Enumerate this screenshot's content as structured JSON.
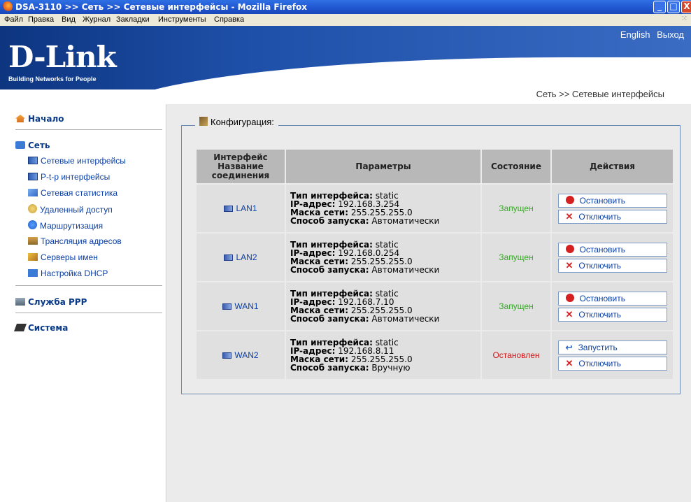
{
  "window": {
    "title": "DSA-3110 >> Сеть >> Сетевые интерфейсы - Mozilla Firefox",
    "min": "_",
    "max": "□",
    "close": "X"
  },
  "menubar": [
    "Файл",
    "Правка",
    "Вид",
    "Журнал",
    "Закладки",
    "Инструменты",
    "Справка"
  ],
  "header": {
    "logo": "D-Link",
    "tagline": "Building Networks for People",
    "lang": "English",
    "logout": "Выход",
    "breadcrumb": "Сеть >> Сетевые интерфейсы"
  },
  "sidebar": {
    "home": "Начало",
    "network": "Сеть",
    "network_items": [
      "Сетевые интерфейсы",
      "P-t-p интерфейсы",
      "Сетевая статистика",
      "Удаленный доступ",
      "Маршрутизация",
      "Трансляция адресов",
      "Серверы имен",
      "Настройка DHCP"
    ],
    "ppp": "Служба PPP",
    "system": "Система"
  },
  "config": {
    "legend": "Конфигурация:",
    "headers": [
      "Интерфейс Название соединения",
      "Параметры",
      "Состояние",
      "Действия"
    ],
    "param_labels": {
      "type": "Тип интерфейса:",
      "ip": "IP-адрес:",
      "mask": "Маска сети:",
      "start": "Способ запуска:"
    },
    "rows": [
      {
        "name": "LAN1",
        "type": "static",
        "ip": "192.168.3.254",
        "mask": "255.255.255.0",
        "start": "Автоматически",
        "state": "Запущен",
        "action1": "Остановить",
        "action2": "Отключить"
      },
      {
        "name": "LAN2",
        "type": "static",
        "ip": "192.168.0.254",
        "mask": "255.255.255.0",
        "start": "Автоматически",
        "state": "Запущен",
        "action1": "Остановить",
        "action2": "Отключить"
      },
      {
        "name": "WAN1",
        "type": "static",
        "ip": "192.168.7.10",
        "mask": "255.255.255.0",
        "start": "Автоматически",
        "state": "Запущен",
        "action1": "Остановить",
        "action2": "Отключить"
      },
      {
        "name": "WAN2",
        "type": "static",
        "ip": "192.168.8.11",
        "mask": "255.255.255.0",
        "start": "Вручную",
        "state": "Остановлен",
        "action1": "Запустить",
        "action2": "Отключить"
      }
    ]
  }
}
